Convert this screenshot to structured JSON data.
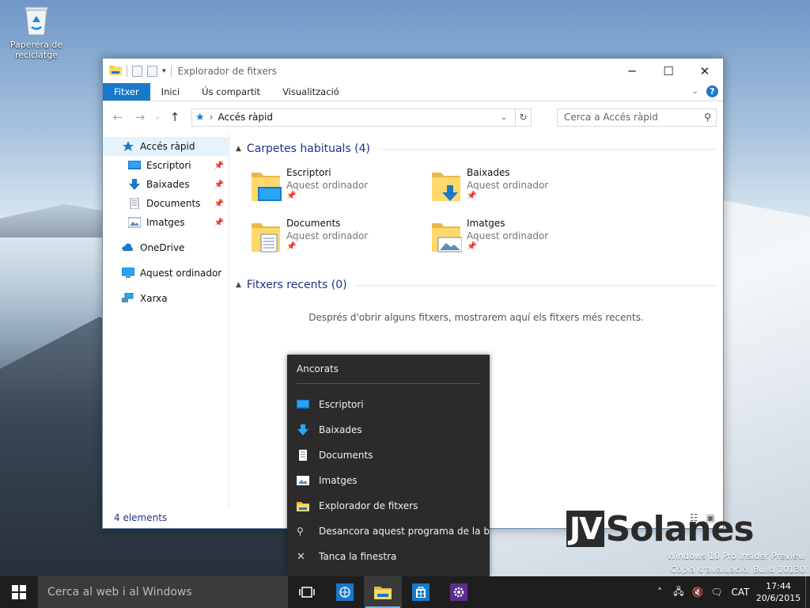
{
  "desktop": {
    "recycle_bin_label": "Paperera de reciclatge",
    "watermark_line1": "Windows 10 Pro Insider Preview",
    "watermark_line2": "Còpia d'avaluació. Build 10130",
    "logo_left": "JV",
    "logo_right": "Solanes"
  },
  "window": {
    "title": "Explorador de fitxers",
    "tabs": [
      "Fitxer",
      "Inici",
      "Ús compartit",
      "Visualització"
    ],
    "address": "Accés ràpid",
    "search_placeholder": "Cerca a Accés ràpid",
    "status": "4 elements"
  },
  "nav": {
    "quick_access": "Accés ràpid",
    "pinned": [
      "Escriptori",
      "Baixades",
      "Documents",
      "Imatges"
    ],
    "onedrive": "OneDrive",
    "this_pc": "Aquest ordinador",
    "network": "Xarxa"
  },
  "content": {
    "frequent_header": "Carpetes habituals (4)",
    "folders": [
      {
        "name": "Escriptori",
        "location": "Aquest ordinador"
      },
      {
        "name": "Baixades",
        "location": "Aquest ordinador"
      },
      {
        "name": "Documents",
        "location": "Aquest ordinador"
      },
      {
        "name": "Imatges",
        "location": "Aquest ordinador"
      }
    ],
    "recent_header": "Fitxers recents (0)",
    "recent_empty": "Després d'obrir alguns fitxers, mostrarem aquí els fitxers més recents."
  },
  "jumplist": {
    "title": "Ancorats",
    "items": [
      "Escriptori",
      "Baixades",
      "Documents",
      "Imatges"
    ],
    "app": "Explorador de fitxers",
    "unpin": "Desancora aquest programa de la ba",
    "close": "Tanca la finestra"
  },
  "taskbar": {
    "search_placeholder": "Cerca al web i al Windows",
    "language": "CAT",
    "time": "17:44",
    "date": "20/6/2015"
  },
  "colors": {
    "accent": "#1979ca",
    "header_blue": "#1e3287",
    "jumplist_bg": "#2b2b2b",
    "taskbar_bg": "#1e1e1e"
  }
}
